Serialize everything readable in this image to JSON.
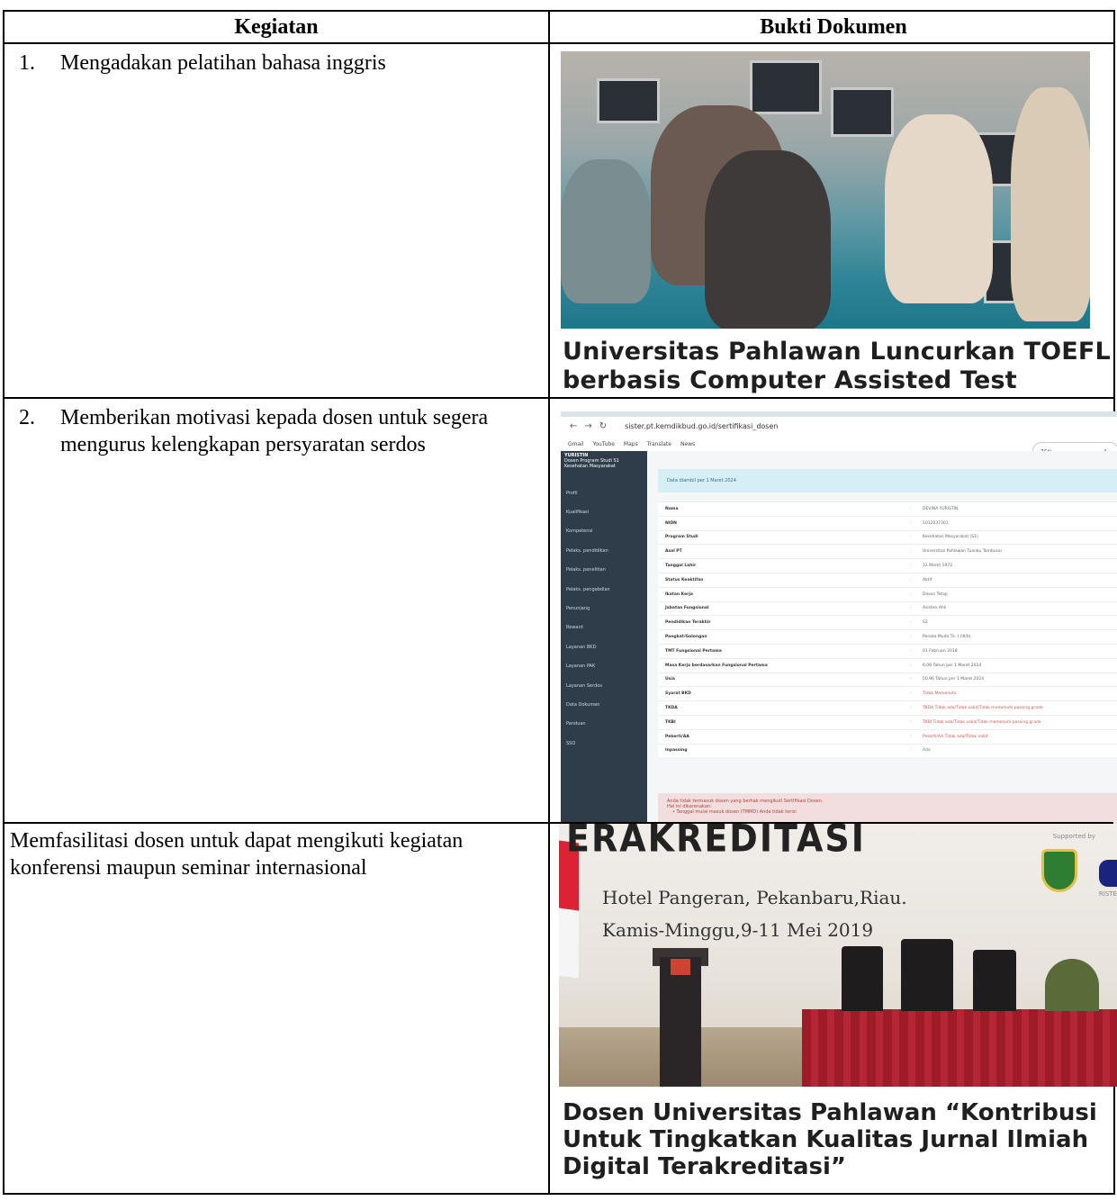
{
  "table": {
    "header_left": "Kegiatan",
    "header_right": "Bukti Dokumen"
  },
  "rows": [
    {
      "number": "1.",
      "activity": "Mengadakan pelatihan bahasa inggris",
      "evidence_headline_line1": "Universitas Pahlawan Luncurkan TOEFL",
      "evidence_headline_line2": "berbasis Computer Assisted Test"
    },
    {
      "number": "2.",
      "activity": "Memberikan motivasi kepada dosen untuk segera mengurus kelengkapan persyaratan serdos"
    },
    {
      "activity": "Memfasilitasi dosen untuk dapat mengikuti kegiatan konferensi maupun seminar internasional",
      "evidence_banner_title": "ERAKREDITASI",
      "evidence_supported": "Supported by",
      "evidence_ristek": "RISTE",
      "evidence_location": "Hotel Pangeran, Pekanbaru,Riau.",
      "evidence_date": "Kamis-Minggu,9-11 Mei 2019",
      "evidence_headline": "Dosen Universitas Pahlawan “Kontribusi Untuk Tingkatkan Kualitas Jurnal Ilmiah Digital Terakreditasi”"
    }
  ],
  "screenshot": {
    "url": "sister.pt.kemdikbud.go.id/sertifikasi_dosen",
    "bookmarks": [
      "Gmail",
      "YouTube",
      "Maps",
      "Translate",
      "News"
    ],
    "zoom": "75%",
    "user_name": "YURISTIN",
    "user_desc": "Dosen Program Studi S1 Kesehatan Masyarakat",
    "sidebar": [
      "Profil",
      "Kualifikasi",
      "Kompetensi",
      "Pelaks. pendidikan",
      "Pelaks. penelitian",
      "Pelaks. pengabdian",
      "Penunjang",
      "Reward",
      "Layanan BKD",
      "Layanan PAK",
      "Layanan Serdos",
      "Data Dokumen",
      "Panduan",
      "SSO"
    ],
    "notice": "Data diambil per 1 Maret 2024",
    "fields": [
      {
        "k": "Nama",
        "v": "DEVINA YURISTIN",
        "style": ""
      },
      {
        "k": "NIDN",
        "v": "1012037301",
        "style": ""
      },
      {
        "k": "Program Studi",
        "v": "Kesehatan Masyarakat (S1)",
        "style": ""
      },
      {
        "k": "Asal PT",
        "v": "Universitas Pahlawan Tuanku Tambusai",
        "style": ""
      },
      {
        "k": "Tanggal Lahir",
        "v": "12 Maret 1973",
        "style": ""
      },
      {
        "k": "Status Keaktifan",
        "v": "Aktif",
        "style": ""
      },
      {
        "k": "Ikatan Kerja",
        "v": "Dosen Tetap",
        "style": ""
      },
      {
        "k": "Jabatan Fungsional",
        "v": "Asisten Ahli",
        "style": ""
      },
      {
        "k": "Pendidikan Terakhir",
        "v": "S2",
        "style": ""
      },
      {
        "k": "Pangkat/Golongan",
        "v": "Penata Muda Tk. I (III/b)",
        "style": ""
      },
      {
        "k": "TMT Fungsional Pertama",
        "v": "01 Februari 2018",
        "style": ""
      },
      {
        "k": "Masa Kerja berdasarkan Fungsional Pertama",
        "v": "6.08 Tahun per 1 Maret 2024",
        "style": ""
      },
      {
        "k": "Usia",
        "v": "50.96 Tahun per 1 Maret 2024",
        "style": ""
      },
      {
        "k": "Syarat BKD",
        "v": "Tidak Memenuhi",
        "style": "red"
      },
      {
        "k": "TKDA",
        "v": "TKDA Tidak ada/Tidak valid/Tidak memenuhi passing grade",
        "style": "red"
      },
      {
        "k": "TKBI",
        "v": "TKBI Tidak ada/Tidak valid/Tidak memenuhi passing grade",
        "style": "red"
      },
      {
        "k": "Pekerti/AA",
        "v": "Pekerti/AA Tidak ada/Tidak valid",
        "style": "red"
      },
      {
        "k": "Inpassing",
        "v": "Ada",
        "style": "green"
      }
    ],
    "alert_line1": "Anda tidak termasuk dosen yang berhak mengikuti Sertifikasi Dosen.",
    "alert_line2": "Hal ini dikarenakan:",
    "alert_line3": "• Tanggal mulai masuk dosen (TMMD) Anda tidak terisi"
  },
  "colors": {
    "border": "#000000",
    "sidebar_bg": "#2f3c4a",
    "notice_bg": "#d6eef5",
    "alert_bg": "#f2dede",
    "error_text": "#d9534f",
    "ok_text": "#3a9a3a"
  }
}
